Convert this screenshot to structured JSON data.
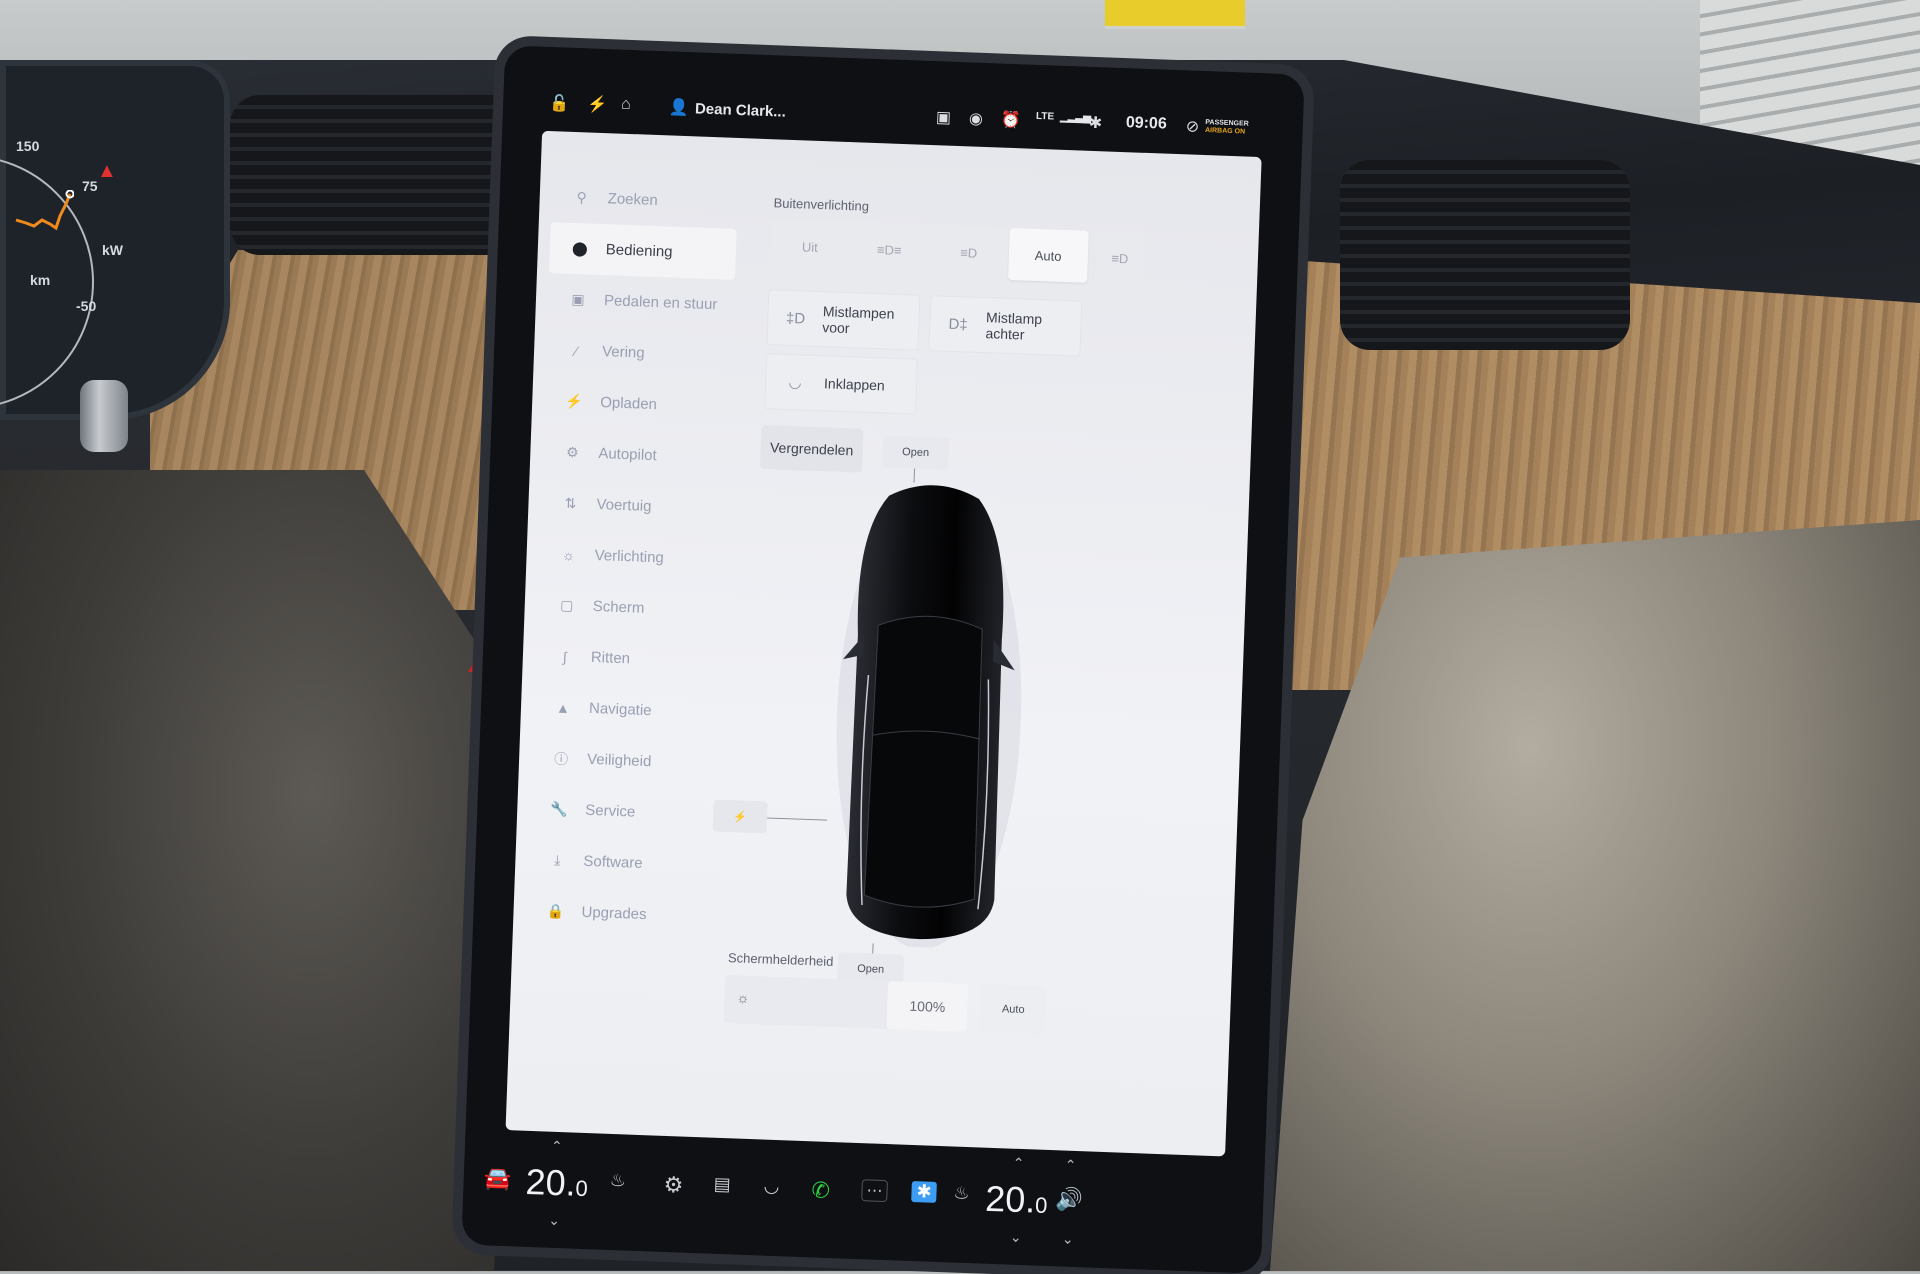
{
  "status_bar": {
    "icons": [
      "lock-open-icon",
      "charge-icon",
      "homelink-icon"
    ],
    "profile_name": "Dean Clark...",
    "right_icons": [
      "dashcam-icon",
      "sentry-icon",
      "alarm-icon"
    ],
    "network": "LTE",
    "time": "09:06",
    "airbag_line1": "PASSENGER",
    "airbag_line2": "AIRBAG ON",
    "accent_orange": "#e8a21a"
  },
  "cluster": {
    "ticks": [
      "150",
      "75",
      "kW",
      "-50"
    ],
    "unit_label": "km"
  },
  "sidebar": {
    "items": [
      {
        "label": "Zoeken",
        "icon": "search-icon",
        "active": false
      },
      {
        "label": "Bediening",
        "icon": "toggle-icon",
        "active": true
      },
      {
        "label": "Pedalen en stuur",
        "icon": "car-icon",
        "active": false
      },
      {
        "label": "Vering",
        "icon": "suspension-icon",
        "active": false
      },
      {
        "label": "Opladen",
        "icon": "charge-icon",
        "active": false
      },
      {
        "label": "Autopilot",
        "icon": "steering-wheel-icon",
        "active": false
      },
      {
        "label": "Voertuig",
        "icon": "sliders-icon",
        "active": false
      },
      {
        "label": "Verlichting",
        "icon": "light-icon",
        "active": false
      },
      {
        "label": "Scherm",
        "icon": "display-icon",
        "active": false
      },
      {
        "label": "Ritten",
        "icon": "trips-icon",
        "active": false
      },
      {
        "label": "Navigatie",
        "icon": "navigation-icon",
        "active": false
      },
      {
        "label": "Veiligheid",
        "icon": "safety-icon",
        "active": false
      },
      {
        "label": "Service",
        "icon": "wrench-icon",
        "active": false
      },
      {
        "label": "Software",
        "icon": "download-icon",
        "active": false
      },
      {
        "label": "Upgrades",
        "icon": "lock-icon",
        "active": false
      }
    ]
  },
  "controls": {
    "exterior_lights_label": "Buitenverlichting",
    "light_modes": [
      "Uit",
      "parking-lights-icon",
      "low-beam-icon",
      "Auto"
    ],
    "selected_light_mode": "Auto",
    "high_beam_icon": "auto-high-beam-icon",
    "front_fog": "Mistlampen voor",
    "rear_fog": "Mistlamp achter",
    "fold_mirrors": "Inklappen",
    "lock_button": "Vergrendelen",
    "frunk_open": "Open",
    "trunk_open": "Open",
    "charge_port_icon": "charge-port-icon",
    "brightness_label": "Schermhelderheid",
    "brightness_value": "100%",
    "brightness_auto": "Auto"
  },
  "dock": {
    "driver_temp": "20.",
    "driver_temp_dec": "0",
    "passenger_temp": "20.",
    "passenger_temp_dec": "0",
    "phone_color": "#2ecc40",
    "bluetooth_color": "#3d9df2"
  }
}
